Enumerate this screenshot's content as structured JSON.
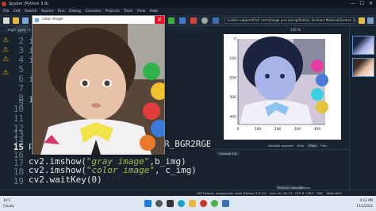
{
  "window": {
    "title": "Spyder (Python 3.9)"
  },
  "menu": [
    "File",
    "Edit",
    "Search",
    "Source",
    "Run",
    "Debug",
    "Consoles",
    "Projects",
    "Tools",
    "View",
    "Help"
  ],
  "toolbar": {
    "path": "ccellen subjects\\Prof. term\\image processing\\Python_Sections Material\\Section 2"
  },
  "editor": {
    "tabs": [
      "...ing2022_2023.editor",
      "pycv"
    ],
    "lines": [
      {
        "n": "2",
        "code": "i"
      },
      {
        "n": "3",
        "code": "i"
      },
      {
        "n": "4",
        "code": "i"
      },
      {
        "n": "5",
        "code": ""
      },
      {
        "n": "6",
        "code": "i"
      },
      {
        "n": "7",
        "code": ""
      },
      {
        "n": "8",
        "code": ""
      },
      {
        "n": "9",
        "code": "i"
      },
      {
        "n": "10",
        "code": ""
      },
      {
        "n": "11",
        "code": ""
      },
      {
        "n": "12",
        "code": ""
      },
      {
        "n": "13",
        "code": ""
      },
      {
        "n": "14",
        "code": ""
      },
      {
        "n": "15",
        "code": "p"
      },
      {
        "n": "16",
        "code": ""
      }
    ],
    "line15_tail": "R_BGR2RGB",
    "line17_a": "cv2.imshow(",
    "line17_str": "\"gray image\"",
    "line17_b": ",b_img)",
    "line18_a": "cv2.imshow(",
    "line18_str": "\"color image\"",
    "line18_b": ", c_img)",
    "line19": "cv2.waitKey(0)"
  },
  "cv_window": {
    "title": "color image",
    "close": "✕"
  },
  "plot": {
    "yticks": [
      "0",
      "100",
      "200",
      "300",
      "400"
    ],
    "xticks": [
      "0",
      "100",
      "200",
      "300",
      "400"
    ],
    "zoom": "145 %"
  },
  "pane_tabs": [
    "Variable explorer",
    "Help",
    "Plots",
    "Files"
  ],
  "console": {
    "tab": "Console 1/A",
    "bottom_tabs": [
      "IPython console",
      "History"
    ]
  },
  "status": {
    "items": [
      "LSP Python: ready",
      "conda: base (Python 3.9.12)",
      "Line 15, Col 13",
      "UTF-8",
      "CRLF",
      "RW",
      "Mem 80%"
    ]
  },
  "taskbar": {
    "weather_temp": "19°C",
    "weather_desc": "Cloudy",
    "time": "9:12 PM",
    "date": "11/1/2022"
  },
  "colors": {
    "bg": "#19232d",
    "accent": "#1e7ad6",
    "close": "#e81123"
  }
}
